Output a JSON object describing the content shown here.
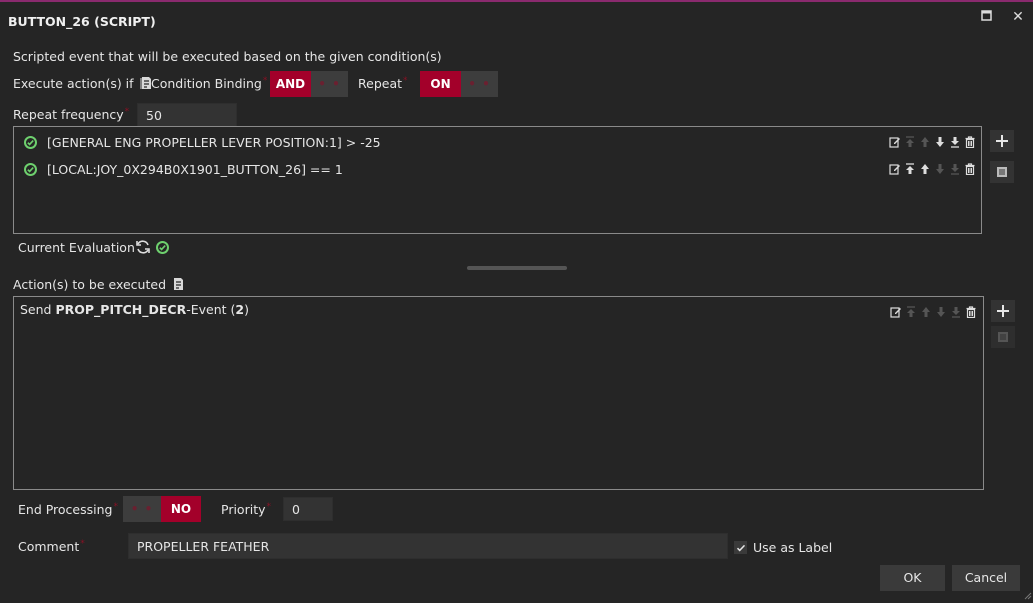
{
  "window": {
    "title": "BUTTON_26 (SCRIPT)"
  },
  "description": "Scripted event that will be executed based on the given condition(s)",
  "condition": {
    "execute_label": "Execute action(s) if",
    "binding_label": "Condition Binding",
    "binding_value": "AND",
    "binding_off": "• •",
    "repeat_label": "Repeat",
    "repeat_value": "ON",
    "repeat_off": "• •",
    "frequency_label": "Repeat frequency",
    "frequency_value": "50"
  },
  "conditions": [
    {
      "text": "[GENERAL ENG PROPELLER LEVER POSITION:1] > -25"
    },
    {
      "text": "[LOCAL:JOY_0X294B0X1901_BUTTON_26] == 1"
    }
  ],
  "evaluation": {
    "label": "Current Evaluation"
  },
  "actions": {
    "label": "Action(s) to be executed",
    "items": [
      {
        "prefix": "Send ",
        "event": "PROP_PITCH_DECR",
        "middle": "-Event (",
        "count": "2",
        "suffix": ")"
      }
    ]
  },
  "end_processing": {
    "label": "End Processing",
    "off": "• •",
    "value": "NO"
  },
  "priority": {
    "label": "Priority",
    "value": "0"
  },
  "comment": {
    "label": "Comment",
    "value": "PROPELLER FEATHER",
    "use_as_label": "Use as Label"
  },
  "buttons": {
    "ok": "OK",
    "cancel": "Cancel"
  },
  "colors": {
    "accent": "#a3002a",
    "check": "#6ed06e",
    "title_border": "#8a2a6e"
  }
}
